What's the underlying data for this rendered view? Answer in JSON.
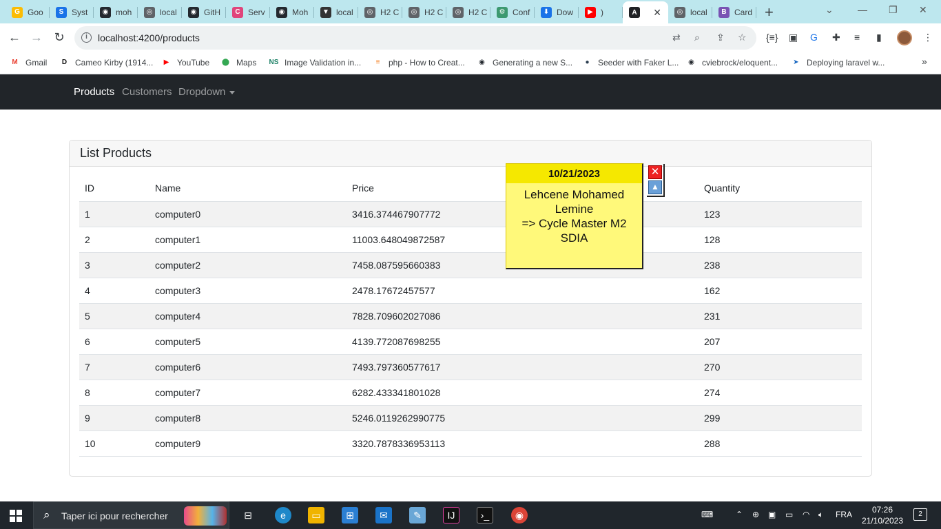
{
  "browser": {
    "tabs": [
      {
        "label": "Goo",
        "color": "#fbbc04",
        "glyph": "G"
      },
      {
        "label": "Syst",
        "color": "#1a73e8",
        "glyph": "S"
      },
      {
        "label": "moh",
        "color": "#24292f",
        "glyph": "◉"
      },
      {
        "label": "local",
        "color": "#5f6368",
        "glyph": "◎"
      },
      {
        "label": "GitH",
        "color": "#24292f",
        "glyph": "◉"
      },
      {
        "label": "Serv",
        "color": "#e0457b",
        "glyph": "C"
      },
      {
        "label": "Moh",
        "color": "#24292f",
        "glyph": "◉"
      },
      {
        "label": "local",
        "color": "#333",
        "glyph": "▼"
      },
      {
        "label": "H2 C",
        "color": "#5f6368",
        "glyph": "◎"
      },
      {
        "label": "H2 C",
        "color": "#5f6368",
        "glyph": "◎"
      },
      {
        "label": "H2 C",
        "color": "#5f6368",
        "glyph": "◎"
      },
      {
        "label": "Conf",
        "color": "#3d9970",
        "glyph": "⚙"
      },
      {
        "label": "Dow",
        "color": "#1a73e8",
        "glyph": "⬇"
      },
      {
        "label": ")",
        "color": "#ff0000",
        "glyph": "▶"
      }
    ],
    "active_tab": {
      "label": "",
      "glyph": "A"
    },
    "trailing_tabs": [
      {
        "label": "local",
        "color": "#5f6368",
        "glyph": "◎"
      },
      {
        "label": "Card",
        "color": "#7952b3",
        "glyph": "B"
      }
    ],
    "new_tab": "+",
    "url": "localhost:4200/products",
    "bookmarks": [
      {
        "label": "Gmail",
        "glyph": "M",
        "color": "#ea4335"
      },
      {
        "label": "Cameo Kirby (1914...",
        "glyph": "D",
        "color": "#111"
      },
      {
        "label": "YouTube",
        "glyph": "▶",
        "color": "#ff0000"
      },
      {
        "label": "Maps",
        "glyph": "⬤",
        "color": "#34a853"
      },
      {
        "label": "Image Validation in...",
        "glyph": "NS",
        "color": "#1a7f64"
      },
      {
        "label": "php - How to Creat...",
        "glyph": "≡",
        "color": "#f48024"
      },
      {
        "label": "Generating a new S...",
        "glyph": "◉",
        "color": "#24292f"
      },
      {
        "label": "Seeder with Faker L...",
        "glyph": "●",
        "color": "#2c3e50"
      },
      {
        "label": "cviebrock/eloquent...",
        "glyph": "◉",
        "color": "#24292f"
      },
      {
        "label": "Deploying laravel w...",
        "glyph": "➤",
        "color": "#1565c0"
      }
    ],
    "bookmarks_more": "»"
  },
  "app_nav": {
    "links": [
      "Products",
      "Customers",
      "Dropdown"
    ]
  },
  "products_card": {
    "title": "List Products",
    "columns": [
      "ID",
      "Name",
      "Price",
      "Quantity"
    ],
    "rows": [
      [
        "1",
        "computer0",
        "3416.374467907772",
        "123"
      ],
      [
        "2",
        "computer1",
        "11003.648049872587",
        "128"
      ],
      [
        "3",
        "computer2",
        "7458.087595660383",
        "238"
      ],
      [
        "4",
        "computer3",
        "2478.17672457577",
        "162"
      ],
      [
        "5",
        "computer4",
        "7828.709602027086",
        "231"
      ],
      [
        "6",
        "computer5",
        "4139.772087698255",
        "207"
      ],
      [
        "7",
        "computer6",
        "7493.797360577617",
        "270"
      ],
      [
        "8",
        "computer7",
        "6282.433341801028",
        "274"
      ],
      [
        "9",
        "computer8",
        "5246.0119262990775",
        "299"
      ],
      [
        "10",
        "computer9",
        "3320.7878336953113",
        "288"
      ]
    ]
  },
  "sticky_note": {
    "date": "10/21/2023",
    "lines": [
      "Lehcene Mohamed",
      "Lemine",
      "=> Cycle Master M2",
      "SDIA"
    ]
  },
  "taskbar": {
    "search_placeholder": "Taper ici pour rechercher",
    "language": "FRA",
    "time": "07:26",
    "date": "21/10/2023",
    "notifications": "2"
  }
}
